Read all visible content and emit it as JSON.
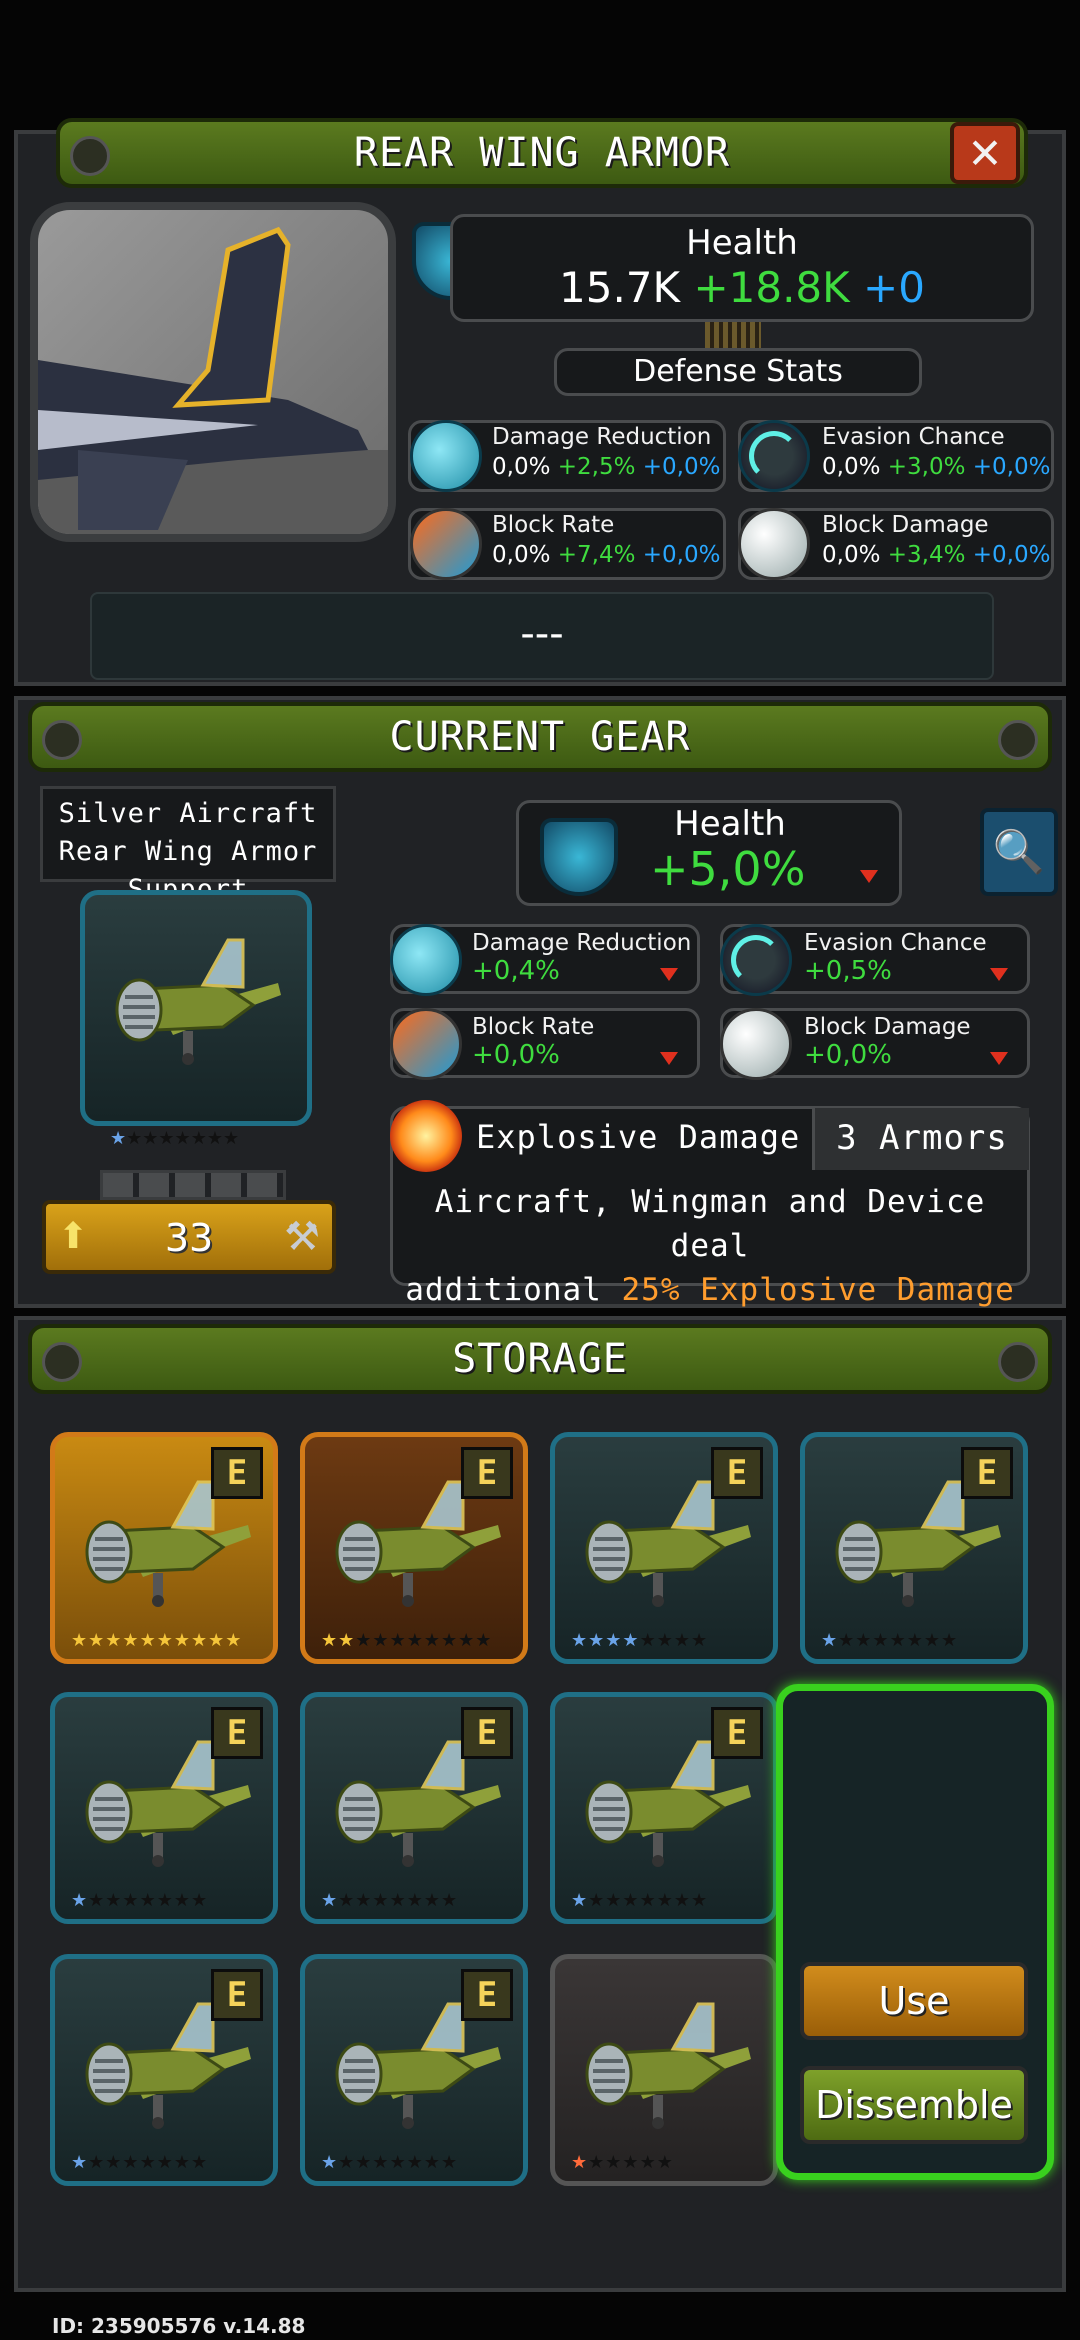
{
  "header": {
    "title": "REAR WING ARMOR",
    "close_label": "✕"
  },
  "health": {
    "label": "Health",
    "base": "15.7K",
    "bonus_green": "+18.8K",
    "bonus_blue": "+0"
  },
  "defense_label": "Defense Stats",
  "stats": [
    {
      "name": "Damage Reduction",
      "base": "0,0%",
      "green": "+2,5%",
      "blue": "+0,0%",
      "icon": "damage-reduction-icon"
    },
    {
      "name": "Evasion Chance",
      "base": "0,0%",
      "green": "+3,0%",
      "blue": "+0,0%",
      "icon": "evasion-icon"
    },
    {
      "name": "Block Rate",
      "base": "0,0%",
      "green": "+7,4%",
      "blue": "+0,0%",
      "icon": "block-rate-icon"
    },
    {
      "name": "Block Damage",
      "base": "0,0%",
      "green": "+3,4%",
      "blue": "+0,0%",
      "icon": "block-damage-icon"
    }
  ],
  "description": "---",
  "current_gear": {
    "banner": "CURRENT GEAR",
    "name": "Silver Aircraft Rear Wing Armor Support",
    "level": "33",
    "health_label": "Health",
    "health_value": "+5,0%",
    "stats": [
      {
        "name": "Damage Reduction",
        "value": "+0,4%"
      },
      {
        "name": "Evasion Chance",
        "value": "+0,5%"
      },
      {
        "name": "Block Rate",
        "value": "+0,0%"
      },
      {
        "name": "Block Damage",
        "value": "+0,0%"
      }
    ],
    "set_name": "Explosive Damage Set",
    "set_count": "3 Armors",
    "set_desc_1": "Aircraft, Wingman and Device deal",
    "set_desc_2a": "additional ",
    "set_desc_2b": "25% Explosive Damage"
  },
  "storage": {
    "banner": "STORAGE",
    "badge": "E",
    "items": [
      {
        "rarity": "gold",
        "stars_filled": 10,
        "stars_total": 10
      },
      {
        "rarity": "bronze",
        "stars_filled": 2,
        "stars_total": 10
      },
      {
        "rarity": "teal",
        "stars_filled": 4,
        "stars_total": 8
      },
      {
        "rarity": "teal",
        "stars_filled": 1,
        "stars_total": 8
      },
      {
        "rarity": "teal",
        "stars_filled": 1,
        "stars_total": 8
      },
      {
        "rarity": "teal",
        "stars_filled": 1,
        "stars_total": 8
      },
      {
        "rarity": "teal",
        "stars_filled": 1,
        "stars_total": 8
      },
      {
        "rarity": "teal",
        "stars_filled": 1,
        "stars_total": 8
      },
      {
        "rarity": "teal",
        "stars_filled": 1,
        "stars_total": 8
      },
      {
        "rarity": "teal",
        "stars_filled": 1,
        "stars_total": 8
      },
      {
        "rarity": "gray",
        "stars_filled": 1,
        "stars_total": 6
      }
    ],
    "use_label": "Use",
    "dissemble_label": "Dissemble"
  },
  "footer": "ID: 235905576  v.14.88"
}
